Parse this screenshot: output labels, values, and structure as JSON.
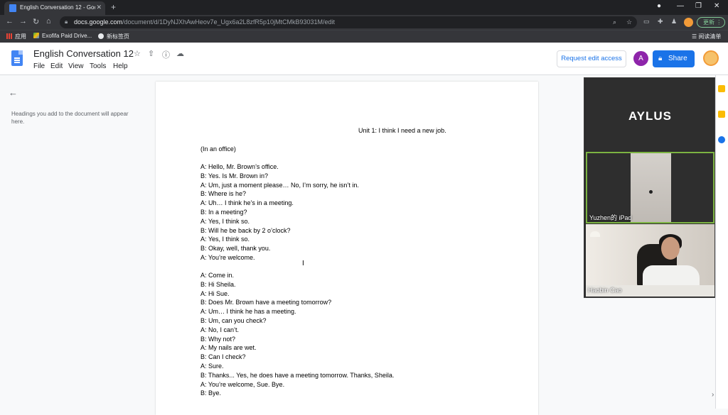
{
  "browser": {
    "tab_title": "English Conversation 12 - Goo",
    "url_host": "docs.google.com",
    "url_path": "/document/d/1DyNJXhAwHeov7e_Ugx6a2L8zfR5p10jMtCMkB93031M/edit",
    "update_label": "更新",
    "bookmarks": [
      "应用",
      "Exofifa Paid Drive...",
      "新标签页"
    ],
    "reading_list": "阅读清单"
  },
  "docs": {
    "title": "English Conversation 12",
    "menu": [
      "File",
      "Edit",
      "View",
      "Tools",
      "Help"
    ],
    "request_edit": "Request edit access",
    "avatar_letter": "A",
    "share": "Share",
    "outline_hint": "Headings you add to the document will appear here."
  },
  "document": {
    "heading": "Unit 1: I think I need a new job.",
    "context": "(In an office)",
    "dialogue1": [
      "A: Hello, Mr. Brown’s office.",
      "B: Yes. Is Mr. Brown in?",
      "A: Um, just a moment please… No, I’m sorry, he isn’t in.",
      "B: Where is he?",
      "A: Uh… I think he’s in a meeting.",
      "B: In a meeting?",
      "A: Yes, I think so.",
      "B: Will he be back by 2 o’clock?",
      "A: Yes, I think so.",
      "B: Okay, well, thank you.",
      "A: You’re welcome."
    ],
    "dialogue2": [
      "A: Come in.",
      "B: Hi Sheila.",
      "A: Hi Sue.",
      "B: Does Mr. Brown have a meeting tomorrow?",
      "A: Um… I think he has a meeting.",
      "B: Um, can you check?",
      "A: No, I can’t.",
      "B: Why not?",
      "A: My nails are wet.",
      "B: Can I check?",
      "A: Sure.",
      "B: Thanks... Yes, he does have a meeting tomorrow. Thanks, Sheila.",
      "A: You’re welcome, Sue. Bye.",
      "B: Bye."
    ]
  },
  "video": {
    "tile1_label": "AYLUS",
    "tile2_name": "Yuzhen的 iPad",
    "tile3_name": "Haobin Cao",
    "active_color": "#7cb342"
  },
  "colors": {
    "accent": "#1a73e8",
    "avatar": "#8e24aa"
  }
}
